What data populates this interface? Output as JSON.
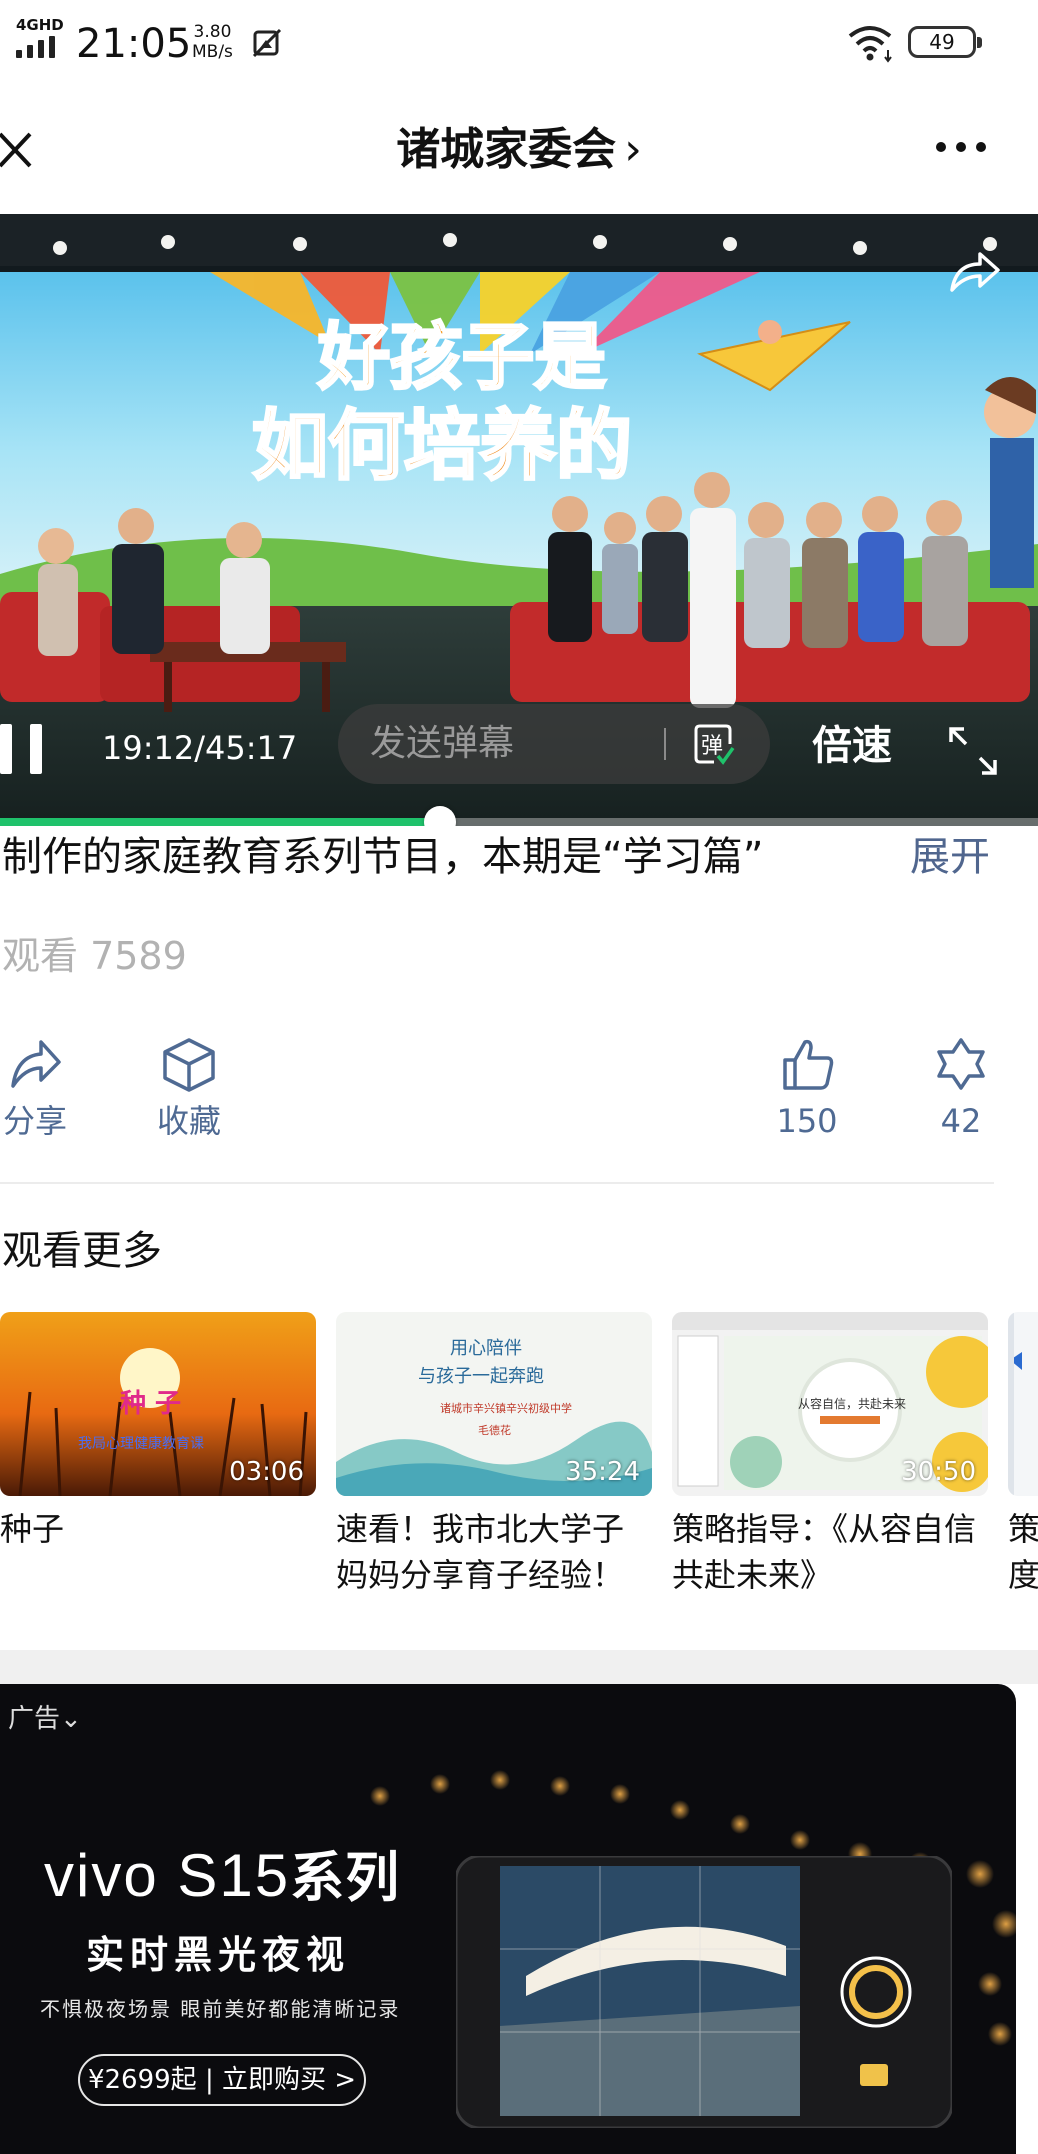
{
  "status_bar": {
    "network": "4GHD",
    "time": "21:05",
    "speed_value": "3.80",
    "speed_unit": "MB/s",
    "battery": "49",
    "icons": [
      "signal-icon",
      "screenshot-icon",
      "wifi-icon",
      "battery-icon"
    ]
  },
  "nav": {
    "title": "诸城家委会",
    "title_chevron": "›",
    "icons": [
      "close-icon",
      "more-icon"
    ]
  },
  "player": {
    "current_time": "19:12",
    "duration": "45:17",
    "time_display": "19:12/45:17",
    "progress_fraction": 0.424,
    "danmu_placeholder": "发送弹幕",
    "danmu_icon_label": "弹",
    "speed_label": "倍速",
    "screen_title_line1": "好孩子是",
    "screen_title_line2": "如何培养的",
    "accent_color": "#1fc26b",
    "icons": [
      "share-icon",
      "pause-icon",
      "danmu-icon",
      "fullscreen-icon"
    ]
  },
  "description": {
    "text": "制作的家庭教育系列节目，本期是“学习篇”",
    "expand_label": "展开",
    "views_label": "观看 7589"
  },
  "actions": {
    "share_label": "分享",
    "favorite_label": "收藏",
    "like_count": "150",
    "looking_count": "42",
    "link_color": "#4f6a93"
  },
  "more": {
    "title": "观看更多",
    "items": [
      {
        "title": "种子",
        "duration": "03:06",
        "thumb_text_1": "种 子",
        "thumb_text_2": "我局心理健康教育课"
      },
      {
        "title": "速看！我市北大学子妈妈分享育子经验！",
        "duration": "35:24",
        "thumb_text_1": "用心陪伴",
        "thumb_text_2": "与孩子一起奔跑",
        "thumb_text_3": "诸城市辛兴镇辛兴初级中学",
        "thumb_text_4": "毛德花"
      },
      {
        "title": "策略指导：《从容自信 共赴未来》",
        "duration": "30:50",
        "thumb_text_1": "从容自信，共赴未来"
      },
      {
        "title": "策度",
        "duration": ""
      }
    ]
  },
  "ad": {
    "label": "广告",
    "label_chevron": "⌄",
    "brand_logo": "vivo S15",
    "brand_suffix": "系列",
    "headline": "实时黑光夜视",
    "subline": "不惧极夜场景 眼前美好都能清晰记录",
    "cta_price": "¥2699起",
    "cta_sep": "|",
    "cta_text": "立即购买 >"
  }
}
